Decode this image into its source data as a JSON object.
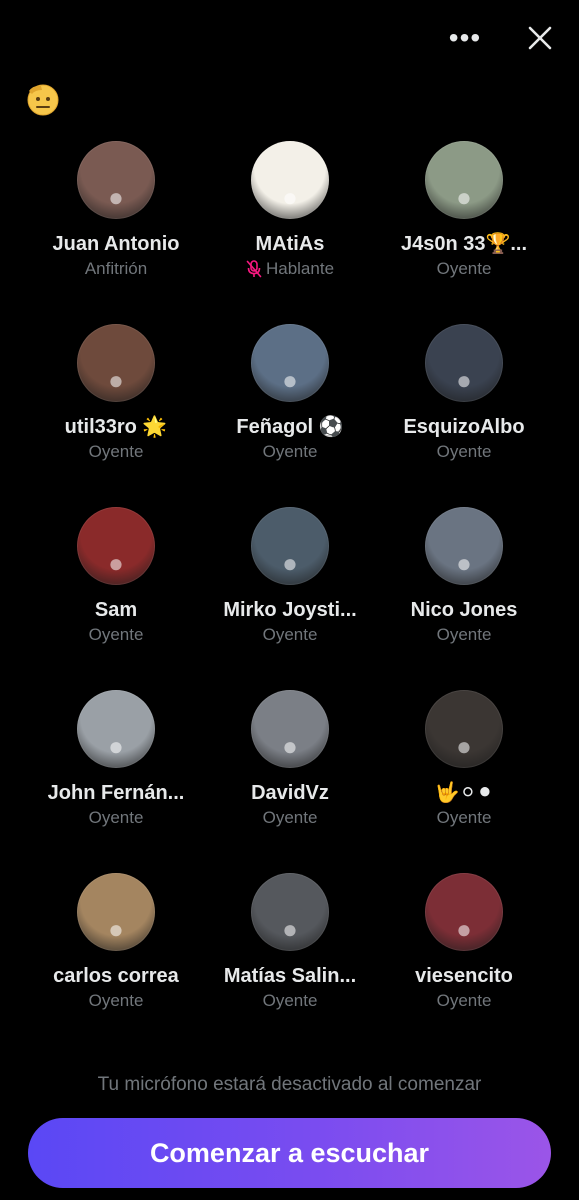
{
  "header": {
    "more_icon": "more-horizontal-icon",
    "more_label": "•••",
    "close_icon": "close-icon",
    "reaction_icon": "saluting-face-emoji-icon",
    "reaction_emoji": "🫡"
  },
  "participants": [
    {
      "name": "Juan Antonio",
      "role": "Anfitrión",
      "avatar": "#7a5a52"
    },
    {
      "name": "MAtiAs",
      "role": "Hablante",
      "muted": true,
      "avatar": "#f3f0e8"
    },
    {
      "name": "J4s0n 33🏆...",
      "role": "Oyente",
      "avatar": "#8c9a86"
    },
    {
      "name": "util33ro 🌟",
      "role": "Oyente",
      "avatar": "#6e4a3c"
    },
    {
      "name": "Feñagol ⚽",
      "role": "Oyente",
      "avatar": "#5c6f86"
    },
    {
      "name": "EsquizoAlbo",
      "role": "Oyente",
      "avatar": "#3a4250"
    },
    {
      "name": "Sam",
      "role": "Oyente",
      "avatar": "#8a2a2a"
    },
    {
      "name": "Mirko Joysti...",
      "role": "Oyente",
      "avatar": "#4c5c6a"
    },
    {
      "name": "Nico Jones",
      "role": "Oyente",
      "avatar": "#6a7482"
    },
    {
      "name": "John Fernán...",
      "role": "Oyente",
      "avatar": "#9aa0a6"
    },
    {
      "name": "DavidVz",
      "role": "Oyente",
      "avatar": "#7b7f86"
    },
    {
      "name": "🤟⚪⚫",
      "role": "Oyente",
      "avatar": "#3b3633"
    },
    {
      "name": "carlos correa",
      "role": "Oyente",
      "avatar": "#a48560"
    },
    {
      "name": "Matías Salin...",
      "role": "Oyente",
      "avatar": "#55585d"
    },
    {
      "name": "viesencito",
      "role": "Oyente",
      "avatar": "#7c2e36"
    }
  ],
  "footer": {
    "note": "Tu micrófono estará desactivado al comenzar",
    "start_button": "Comenzar a escuchar"
  },
  "colors": {
    "background": "#000000",
    "name_text": "#e7e9ea",
    "secondary_text": "#71767b",
    "muted_mic": "#f91880",
    "button_gradient_start": "#5a48f5",
    "button_gradient_end": "#9b55e8"
  }
}
